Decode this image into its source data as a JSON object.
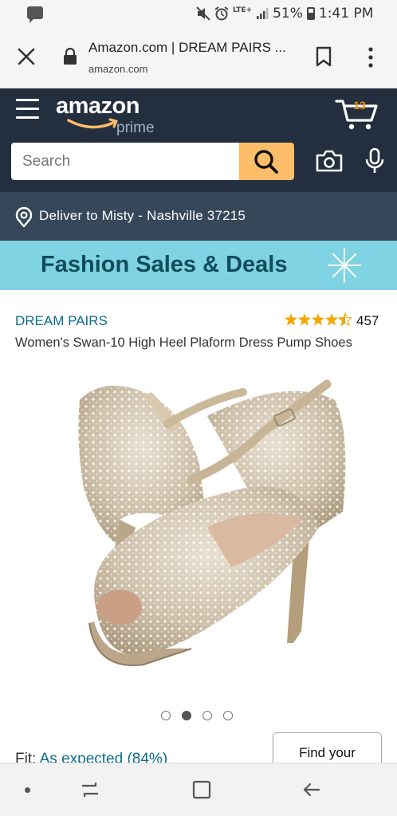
{
  "status_bar": {
    "battery_percent": "51%",
    "time": "1:41 PM",
    "network": "LTE+",
    "icons": [
      "message-icon",
      "mute-icon",
      "alarm-icon",
      "signal-icon",
      "battery-icon"
    ]
  },
  "browser": {
    "page_title": "Amazon.com | DREAM PAIRS ...",
    "domain": "amazon.com",
    "icons": [
      "close-icon",
      "lock-icon",
      "bookmark-icon",
      "more-vert-icon"
    ]
  },
  "header": {
    "logo_text": "amazon",
    "logo_sub": "prime",
    "cart_count": "13",
    "search_placeholder": "Search",
    "icons": [
      "hamburger-icon",
      "cart-icon",
      "search-icon",
      "camera-icon",
      "mic-icon"
    ],
    "colors": {
      "header_bg": "#232f3e",
      "search_button": "#febd69",
      "cart_count": "#f08804"
    }
  },
  "delivery": {
    "text": "Deliver to Misty - Nashville 37215",
    "icon": "location-pin-icon"
  },
  "banner": {
    "text": "Fashion Sales & Deals",
    "bg_color": "#7fd3e3"
  },
  "product": {
    "brand": "DREAM PAIRS",
    "rating": 4.5,
    "review_count": "457",
    "title": "Women's Swan-10 High Heel Plaform Dress Pump Shoes",
    "image_alt": "shoe-product-image",
    "carousel": {
      "total": 4,
      "active": 2
    }
  },
  "fit": {
    "label": "Fit:",
    "value": "As expected (84%)",
    "button_label": "Find your"
  },
  "nav_bar": {
    "icons": [
      "nav-dot-icon",
      "recent-apps-icon",
      "home-icon",
      "back-icon"
    ]
  }
}
